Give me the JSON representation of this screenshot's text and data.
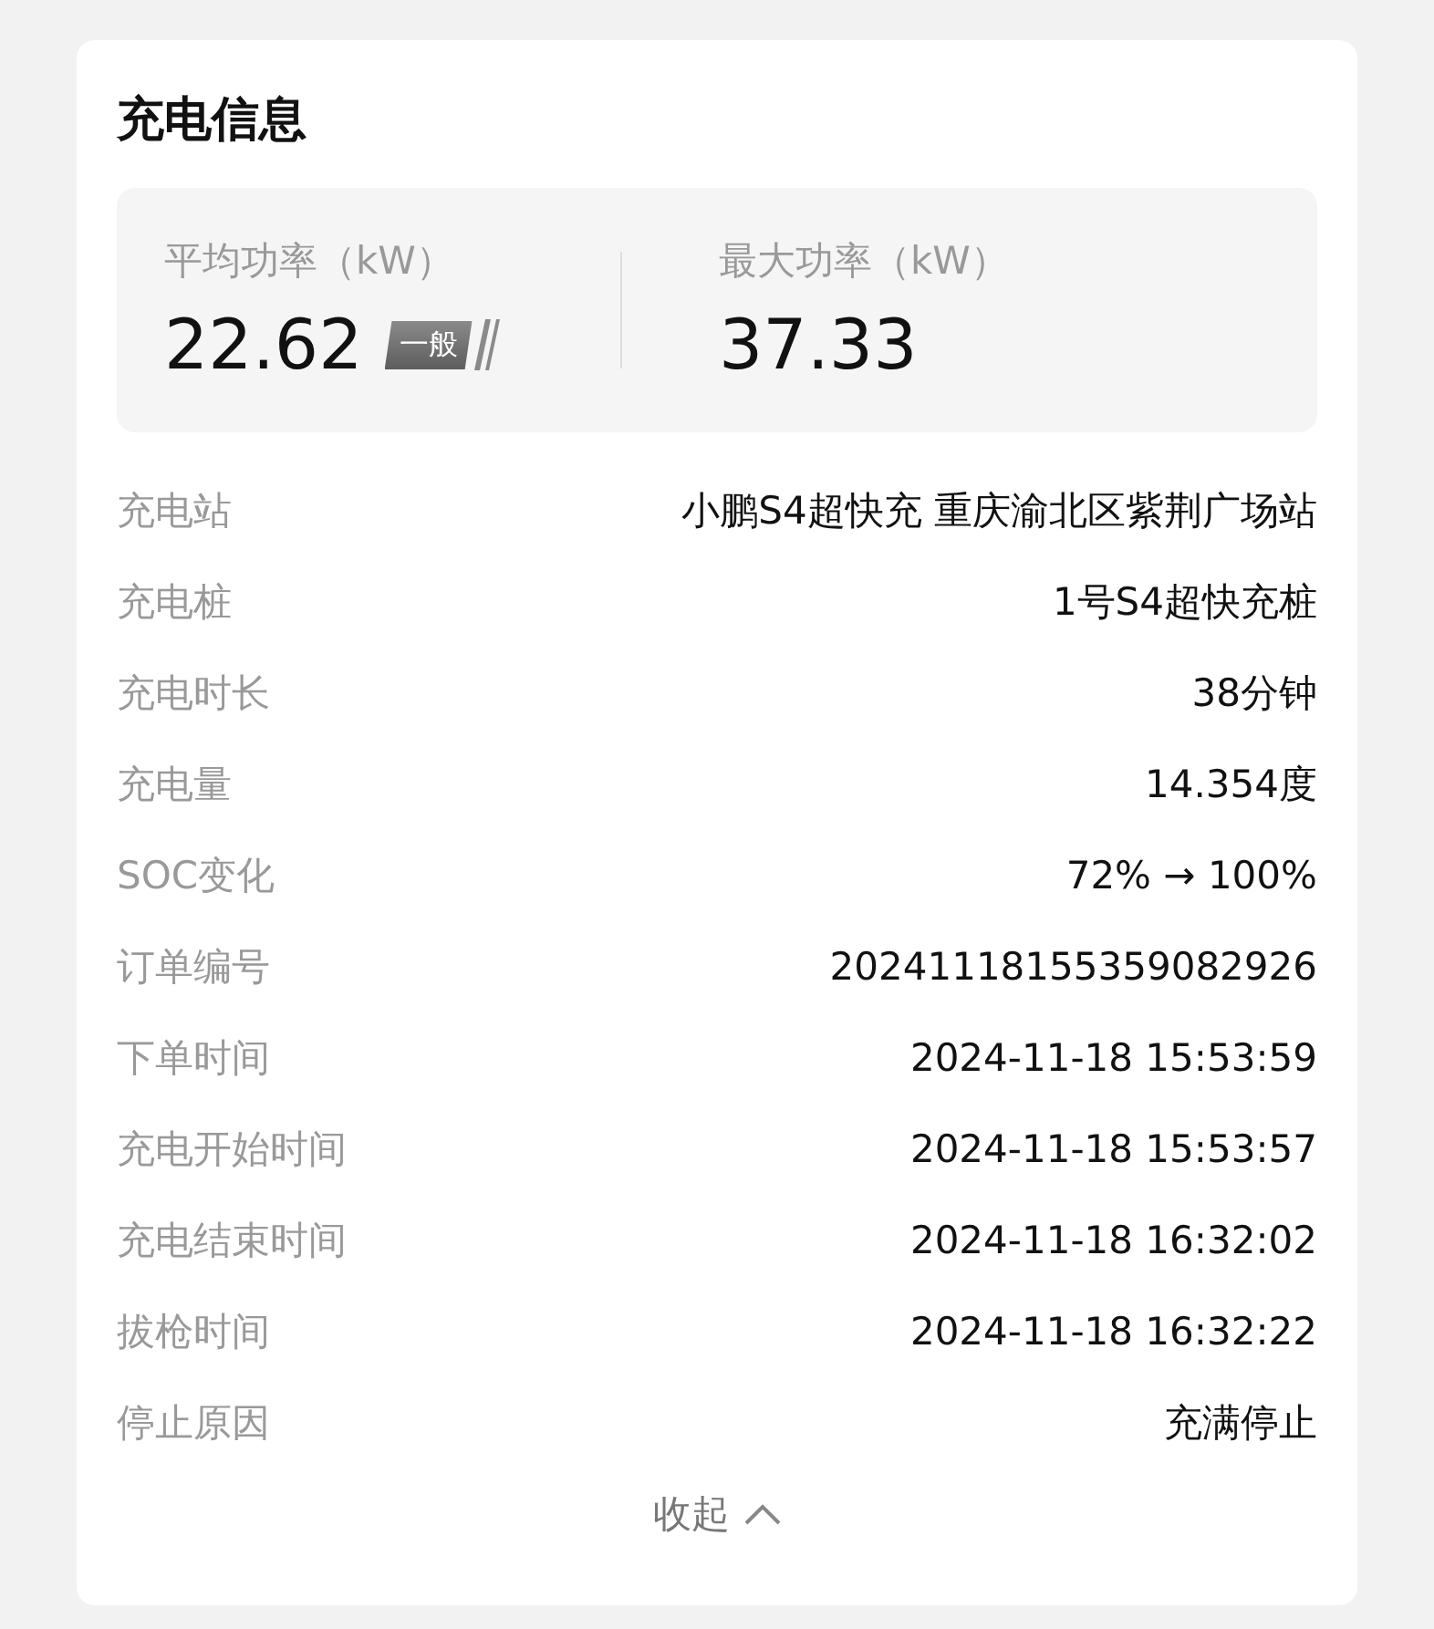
{
  "title": "充电信息",
  "stats": [
    {
      "label": "平均功率（kW）",
      "value": "22.62",
      "badge": "一般"
    },
    {
      "label": "最大功率（kW）",
      "value": "37.33"
    }
  ],
  "rows": [
    {
      "label": "充电站",
      "value": "小鹏S4超快充 重庆渝北区紫荆广场站"
    },
    {
      "label": "充电桩",
      "value": "1号S4超快充桩"
    },
    {
      "label": "充电时长",
      "value": "38分钟"
    },
    {
      "label": "充电量",
      "value": "14.354度"
    },
    {
      "label": "SOC变化",
      "value": "72% → 100%"
    },
    {
      "label": "订单编号",
      "value": "20241118155359082926"
    },
    {
      "label": "下单时间",
      "value": "2024-11-18 15:53:59"
    },
    {
      "label": "充电开始时间",
      "value": "2024-11-18 15:53:57"
    },
    {
      "label": "充电结束时间",
      "value": "2024-11-18 16:32:02"
    },
    {
      "label": "拔枪时间",
      "value": "2024-11-18 16:32:22"
    },
    {
      "label": "停止原因",
      "value": "充满停止"
    }
  ],
  "collapse": "收起"
}
